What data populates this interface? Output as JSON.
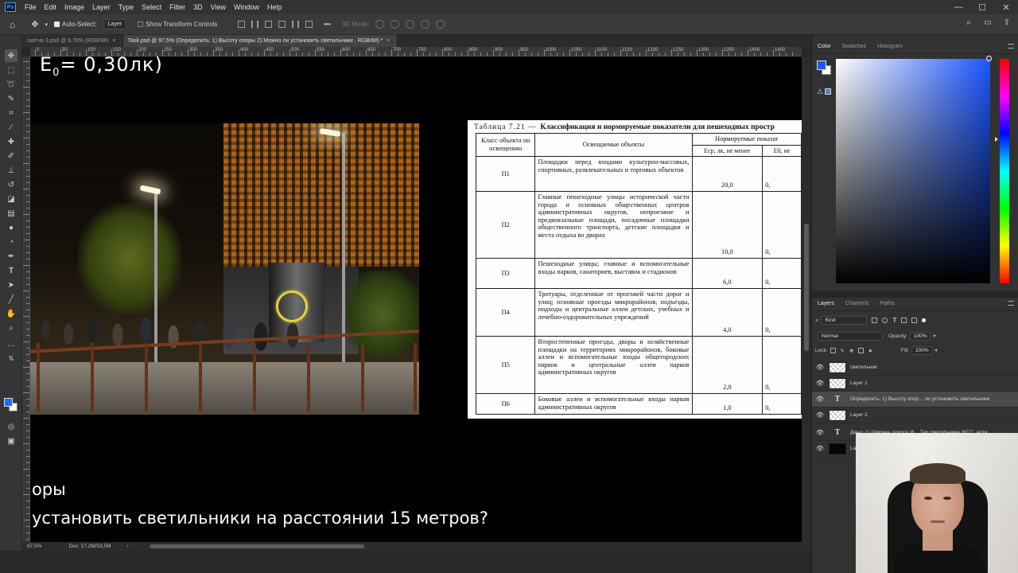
{
  "app": {
    "logo": "Ps",
    "menu": [
      "File",
      "Edit",
      "Image",
      "Layer",
      "Type",
      "Select",
      "Filter",
      "3D",
      "View",
      "Window",
      "Help"
    ],
    "window_controls": [
      "—",
      "☐",
      "✕"
    ]
  },
  "options_bar": {
    "auto_select_label": "Auto-Select:",
    "auto_select_target": "Layer",
    "show_transform_label": "Show Transform Controls",
    "mode_3d_label": "3D Mode:",
    "more_label": "•••"
  },
  "doc_tabs": [
    {
      "label": "скетчи 3.psd @ 9,78% (RGB/8#)",
      "close": "×",
      "active": false
    },
    {
      "label": "Task.psd @ 97,5% (Определить: 1) Высоту опоры 2) Можно ли установить светильники , RGB/8#) *",
      "close": "×",
      "active": true
    }
  ],
  "ruler_top": [
    "0",
    "50",
    "100",
    "150",
    "200",
    "250",
    "300",
    "350",
    "400",
    "450",
    "500",
    "550",
    "600",
    "650",
    "700",
    "750",
    "800",
    "850",
    "900",
    "950",
    "1000",
    "1050",
    "1100",
    "1150",
    "1200",
    "1250",
    "1300",
    "1350",
    "1400",
    "1450"
  ],
  "canvas": {
    "e0_label": "E",
    "e0_sub": "0",
    "e0_value": "= 0,30лк)",
    "caption_line1": "оры",
    "caption_line2": "установить светильники на расстоянии 15 метров?"
  },
  "scan_table": {
    "title_num": "Таблица 7.21 —",
    "title_text": "Классификация и нормируемые показатели для пешеходных простр",
    "header_class": "Класс объекта по освещению",
    "header_objects": "Освещаемые объекты",
    "header_norm": "Нормируемые показат",
    "header_eav": "Eср, лк, не менее",
    "header_emin": "E0, не",
    "rows": [
      {
        "cls": "П1",
        "objects": "Площадки перед входами культурно-массовых, спортивных, развлекательных и торговых объектов",
        "eav": "20,0",
        "emin": "0,"
      },
      {
        "cls": "П2",
        "objects": "Главные пешеходные улицы исторической части города и основных общественных центров административных округов, непроезжие и предвокзальные площади, посадочные площадки общественного транспорта, детские площадки и места отдыха во дворах",
        "eav": "10,0",
        "emin": "0,"
      },
      {
        "cls": "П3",
        "objects": "Пешеходные улицы; главные и вспомогательные входы парков, санаториев, выставок и стадионов",
        "eav": "6,0",
        "emin": "0,"
      },
      {
        "cls": "П4",
        "objects": "Тротуары, отделенные от проезжей части дорог и улиц; основные проезды микрорайонов, подъезды, подходы и центральные аллеи детских, учебных и лечебно-оздоровительных учреждений",
        "eav": "4,0",
        "emin": "0,"
      },
      {
        "cls": "П5",
        "objects": "Второстепенные проезды, дворы и хозяйственные площадки на территориях микрорайонов, боковые аллеи и вспомогательные входы общегородских парков и центральные аллеи парков административных округов",
        "eav": "2,0",
        "emin": "0,"
      },
      {
        "cls": "П6",
        "objects": "Боковые аллеи и вспомогательные входы парков административных округов",
        "eav": "1,0",
        "emin": "0,"
      }
    ]
  },
  "status_bar": {
    "zoom": "97,5%",
    "doc_size": "Doc: 17,2M/53,5M",
    "arrow": "›"
  },
  "color_panel": {
    "tabs": [
      "Color",
      "Swatches",
      "Histogram"
    ],
    "fg_color": "#1d5bff",
    "bg_color": "#ffffff"
  },
  "layers_panel": {
    "tabs": [
      "Layers",
      "Channels",
      "Paths"
    ],
    "filter_kind": "Kind",
    "blend_mode": "Normal",
    "opacity_label": "Opacity:",
    "opacity_value": "100%",
    "lock_label": "Lock:",
    "fill_label": "Fill:",
    "fill_value": "100%",
    "layers": [
      {
        "name": "светильник",
        "thumb": "transparent",
        "selected": false
      },
      {
        "name": "Layer 1",
        "thumb": "transparent",
        "selected": false
      },
      {
        "name": "Определить: 1) Высоту опор... ли установить светильники",
        "thumb": "text",
        "selected": true
      },
      {
        "name": "Layer 2",
        "thumb": "transparent",
        "selected": false
      },
      {
        "name": "Дано: 1) Ширина дороги (6 ...Тип светильника (КСС, арти",
        "thumb": "text",
        "selected": false
      },
      {
        "name": "Layer 0",
        "thumb": "black",
        "selected": false
      }
    ]
  }
}
